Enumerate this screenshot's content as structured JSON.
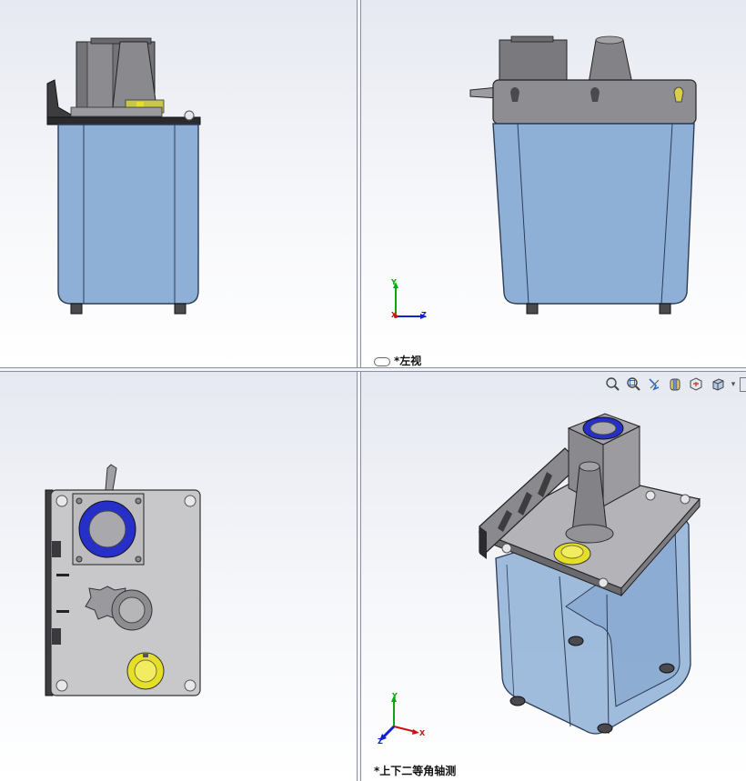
{
  "viewports": {
    "front": {
      "label": ""
    },
    "left": {
      "label": "*左视"
    },
    "top": {
      "label": ""
    },
    "isometric": {
      "label": "*上下二等角轴测"
    }
  },
  "triad": {
    "x": "X",
    "y": "Y",
    "z": "Z"
  },
  "heads_up_toolbar": {
    "buttons": [
      {
        "icon": "zoom-to-fit-icon"
      },
      {
        "icon": "zoom-to-area-icon"
      },
      {
        "icon": "previous-view-icon"
      },
      {
        "icon": "section-view-icon"
      },
      {
        "icon": "view-orientation-icon"
      },
      {
        "icon": "display-style-icon"
      }
    ],
    "dropdown": "▾"
  },
  "colors": {
    "tank": "#8fb0d6",
    "tank_edge": "#2c3c56",
    "metal": "#a9a9ad",
    "metal_dark": "#5d5d62",
    "blue_ring": "#2630c8",
    "yellow_gauge": "#e6df2a",
    "axis_x": "#cc1111",
    "axis_y": "#11a311",
    "axis_z": "#1122cc"
  }
}
